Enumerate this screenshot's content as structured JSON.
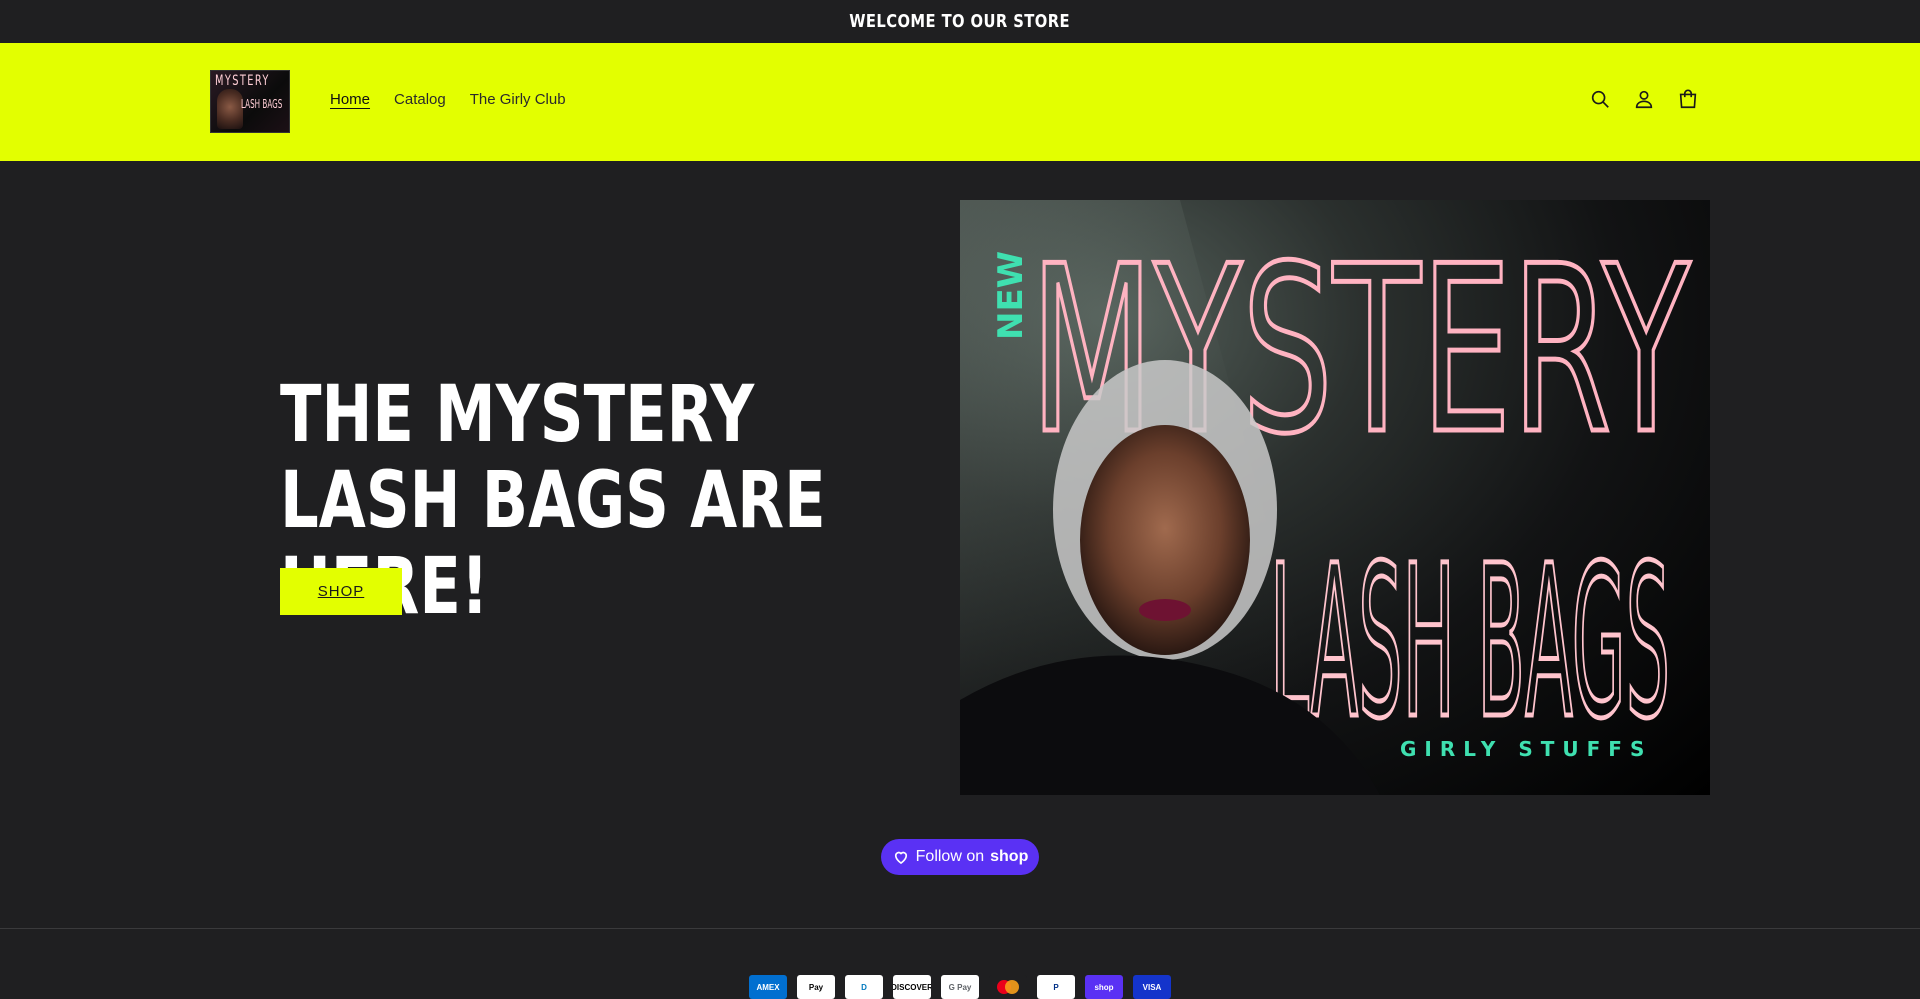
{
  "announcement": {
    "text": "WELCOME TO OUR STORE"
  },
  "header": {
    "logo_alt": "Mystery Lash Bags",
    "logo_text_top": "MYSTERY",
    "logo_text_mid": "LASH BAGS",
    "nav": [
      {
        "label": "Home",
        "active": true
      },
      {
        "label": "Catalog",
        "active": false
      },
      {
        "label": "The Girly Club",
        "active": false
      }
    ],
    "icons": [
      "search-icon",
      "account-icon",
      "cart-icon"
    ]
  },
  "hero": {
    "title": "THE MYSTERY LASH BAGS ARE HERE!",
    "button_label": "SHOP",
    "image": {
      "badge": "NEW",
      "headline": "MYSTERY",
      "subheadline": "LASH BAGS",
      "tagline": "GIRLY STUFFS"
    }
  },
  "follow": {
    "text": "Follow on",
    "brand": "shop"
  },
  "payments": [
    {
      "name": "American Express",
      "abbr": "AMEX",
      "bg": "#016fd0",
      "fg": "#ffffff"
    },
    {
      "name": "Apple Pay",
      "abbr": "Pay",
      "bg": "#ffffff",
      "fg": "#000000"
    },
    {
      "name": "Diners Club",
      "abbr": "D",
      "bg": "#ffffff",
      "fg": "#0079be"
    },
    {
      "name": "Discover",
      "abbr": "DISCOVER",
      "bg": "#ffffff",
      "fg": "#000000"
    },
    {
      "name": "Google Pay",
      "abbr": "G Pay",
      "bg": "#ffffff",
      "fg": "#5f6368"
    },
    {
      "name": "Mastercard",
      "abbr": "",
      "bg": "#1f1f21",
      "fg": "#ffffff"
    },
    {
      "name": "PayPal",
      "abbr": "P",
      "bg": "#ffffff",
      "fg": "#003087"
    },
    {
      "name": "Shop Pay",
      "abbr": "shop",
      "bg": "#5a31f4",
      "fg": "#ffffff"
    },
    {
      "name": "Visa",
      "abbr": "VISA",
      "bg": "#1434cb",
      "fg": "#ffffff"
    }
  ],
  "colors": {
    "accent": "#e3ff00",
    "background": "#1f1f21",
    "shop_purple": "#5a31f4"
  }
}
